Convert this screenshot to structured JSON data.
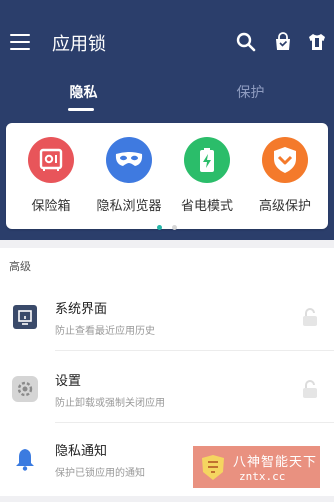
{
  "app": {
    "title": "应用锁"
  },
  "tabs": [
    {
      "label": "隐私",
      "active": true
    },
    {
      "label": "保护",
      "active": false
    }
  ],
  "top_icons": [
    "search-icon",
    "shopping-bag-icon",
    "theme-shirt-icon"
  ],
  "features": [
    {
      "label": "保险箱",
      "icon": "safe-icon",
      "color": "#e8555a"
    },
    {
      "label": "隐私浏览器",
      "icon": "mask-icon",
      "color": "#3f7ae0"
    },
    {
      "label": "省电模式",
      "icon": "battery-icon",
      "color": "#2bbd6a"
    },
    {
      "label": "高级保护",
      "icon": "shield-icon",
      "color": "#f47a2b"
    }
  ],
  "pager": {
    "active_dot_color": "#26b5a8",
    "inactive_dot_color": "#d6d6d6"
  },
  "section": {
    "title": "高级"
  },
  "rows": [
    {
      "name": "系统界面",
      "desc": "防止查看最近应用历史",
      "icon": "system-ui-icon"
    },
    {
      "name": "设置",
      "desc": "防止卸载或强制关闭应用",
      "icon": "settings-gear-icon"
    },
    {
      "name": "隐私通知",
      "desc": "保护已锁应用的通知",
      "icon": "bell-icon"
    }
  ],
  "watermark": {
    "title": "八神智能天下",
    "url": "zntx.cc"
  },
  "colors": {
    "header": "#2b3e6b",
    "bell": "#3b7be0"
  }
}
